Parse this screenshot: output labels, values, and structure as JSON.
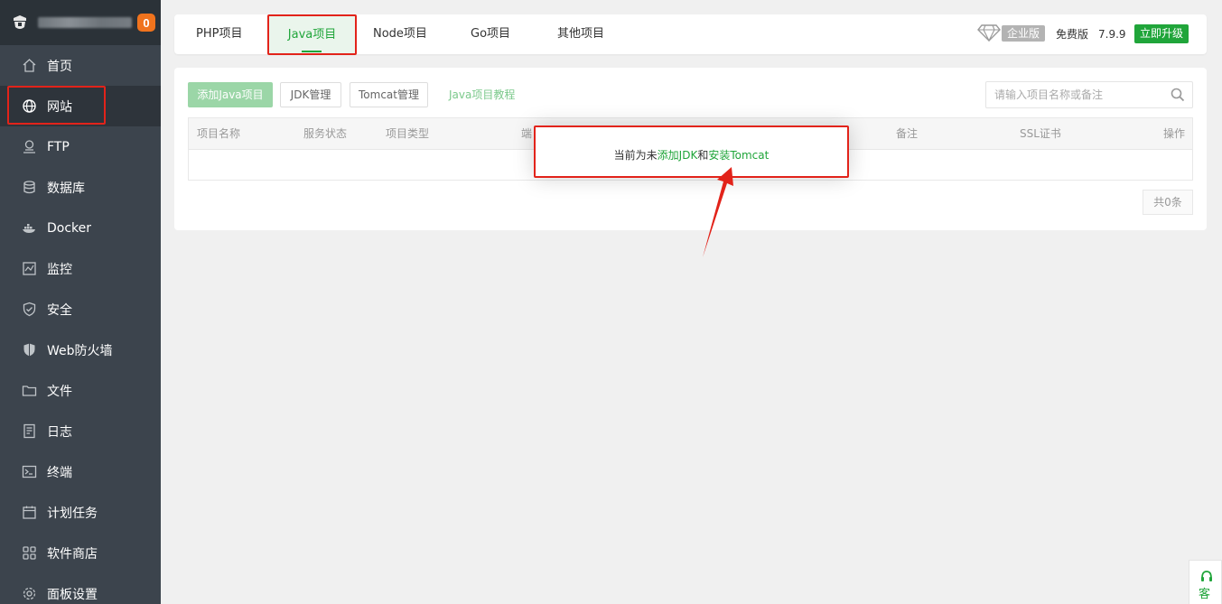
{
  "sidebar": {
    "badge_count": "0",
    "items": [
      {
        "label": "首页",
        "icon": "home-icon"
      },
      {
        "label": "网站",
        "icon": "globe-icon"
      },
      {
        "label": "FTP",
        "icon": "ftp-icon"
      },
      {
        "label": "数据库",
        "icon": "database-icon"
      },
      {
        "label": "Docker",
        "icon": "docker-icon"
      },
      {
        "label": "监控",
        "icon": "monitor-icon"
      },
      {
        "label": "安全",
        "icon": "shield-icon"
      },
      {
        "label": "Web防火墙",
        "icon": "firewall-icon"
      },
      {
        "label": "文件",
        "icon": "folder-icon"
      },
      {
        "label": "日志",
        "icon": "log-icon"
      },
      {
        "label": "终端",
        "icon": "terminal-icon"
      },
      {
        "label": "计划任务",
        "icon": "calendar-icon"
      },
      {
        "label": "软件商店",
        "icon": "grid-icon"
      },
      {
        "label": "面板设置",
        "icon": "gear-icon"
      }
    ]
  },
  "topbar": {
    "tabs": [
      {
        "label": "PHP项目"
      },
      {
        "label": "Java项目"
      },
      {
        "label": "Node项目"
      },
      {
        "label": "Go项目"
      },
      {
        "label": "其他项目"
      }
    ],
    "enterprise_label": "企业版",
    "free_label": "免费版",
    "version": "7.9.9",
    "upgrade_label": "立即升级"
  },
  "toolbar": {
    "add_java_label": "添加Java项目",
    "jdk_label": "JDK管理",
    "tomcat_label": "Tomcat管理",
    "tutorial_label": "Java项目教程",
    "search_placeholder": "请输入项目名称或备注"
  },
  "table": {
    "columns": [
      "项目名称",
      "服务状态",
      "项目类型",
      "端",
      "备注",
      "SSL证书",
      "操作"
    ]
  },
  "pager": {
    "total_label": "共0条"
  },
  "popup": {
    "prefix": "当前为未",
    "link1": "添加JDK",
    "middle": "和",
    "link2": "安装Tomcat"
  },
  "service": {
    "label": "客"
  },
  "colors": {
    "accent": "#20a53a",
    "highlight": "#e2231a",
    "sidebar_bg": "#3c444d"
  }
}
